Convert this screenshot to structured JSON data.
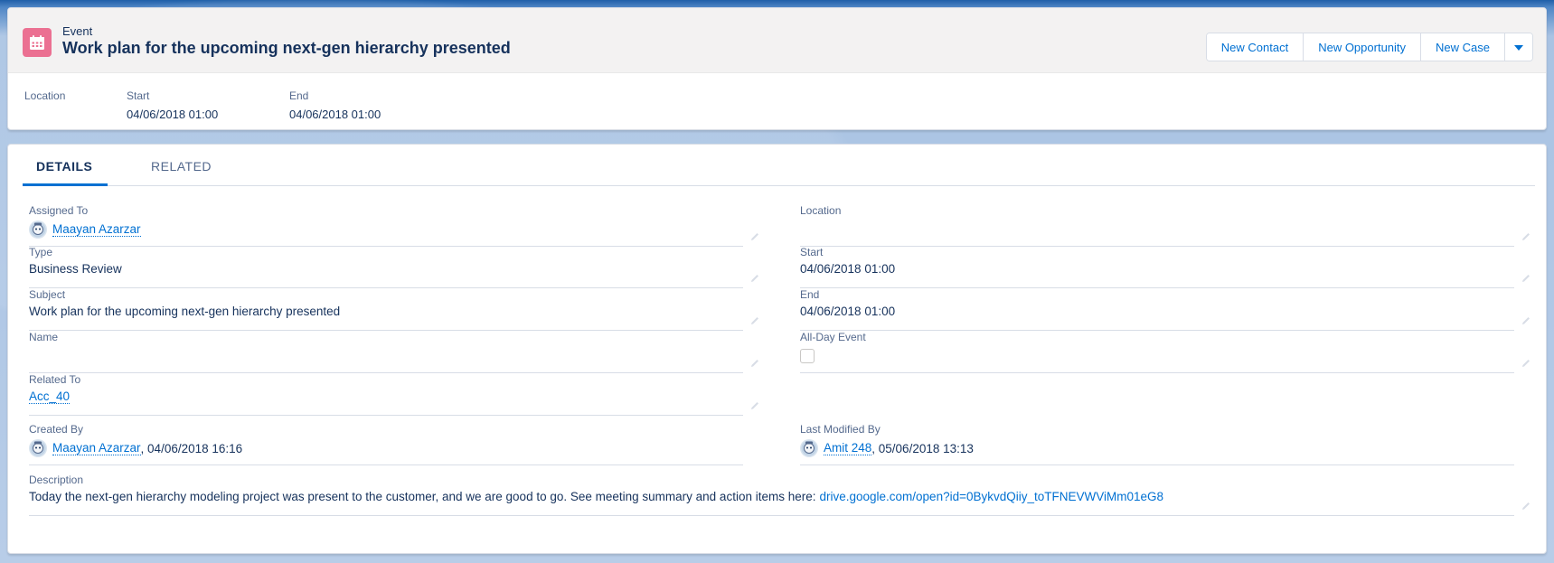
{
  "header": {
    "object_type": "Event",
    "title": "Work plan for the upcoming next-gen hierarchy presented",
    "buttons": {
      "new_contact": "New Contact",
      "new_opportunity": "New Opportunity",
      "new_case": "New Case"
    },
    "highlights": [
      {
        "label": "Location",
        "value": ""
      },
      {
        "label": "Start",
        "value": "04/06/2018 01:00"
      },
      {
        "label": "End",
        "value": "04/06/2018 01:00"
      }
    ]
  },
  "tabs": [
    {
      "label": "DETAILS",
      "active": true
    },
    {
      "label": "RELATED",
      "active": false
    }
  ],
  "fields": {
    "assigned_to": {
      "label": "Assigned To",
      "value": "Maayan Azarzar"
    },
    "type": {
      "label": "Type",
      "value": "Business Review"
    },
    "subject": {
      "label": "Subject",
      "value": "Work plan for the upcoming next-gen hierarchy presented"
    },
    "name": {
      "label": "Name",
      "value": ""
    },
    "related_to": {
      "label": "Related To",
      "value": "Acc_40"
    },
    "location": {
      "label": "Location",
      "value": ""
    },
    "start": {
      "label": "Start",
      "value": "04/06/2018 01:00"
    },
    "end": {
      "label": "End",
      "value": "04/06/2018 01:00"
    },
    "all_day_event": {
      "label": "All-Day Event",
      "checked": false
    },
    "created_by": {
      "label": "Created By",
      "user": "Maayan Azarzar",
      "date": ", 04/06/2018 16:16"
    },
    "last_modified_by": {
      "label": "Last Modified By",
      "user": "Amit 248",
      "date": ", 05/06/2018 13:13"
    },
    "description": {
      "label": "Description",
      "text": "Today the next-gen hierarchy modeling project was present to the customer, and we are good to go. See meeting summary and action items here: ",
      "link": "drive.google.com/open?id=0BykvdQiiy_toTFNEVWViMm01eG8"
    }
  },
  "colors": {
    "brand_blue": "#0070d2",
    "event_icon": "#eb7092",
    "text_primary": "#16325c",
    "text_label": "#54698d"
  }
}
